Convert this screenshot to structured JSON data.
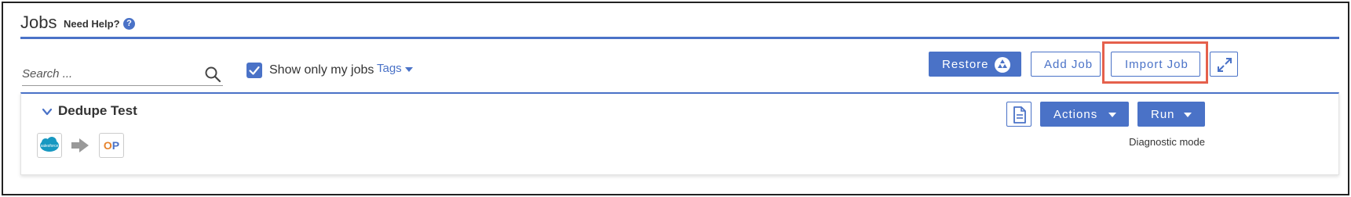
{
  "header": {
    "title": "Jobs",
    "help_label": "Need Help?",
    "help_icon": "question-circle-icon"
  },
  "toolbar": {
    "search_placeholder": "Search ...",
    "search_value": "",
    "show_only_my_jobs_label": "Show only my jobs",
    "show_only_my_jobs_checked": true,
    "tags_label": "Tags",
    "restore_label": "Restore",
    "add_job_label": "Add Job",
    "import_job_label": "Import Job"
  },
  "job": {
    "name": "Dedupe Test",
    "source_logo_text": "salesforce",
    "destination_logo_text": "OP",
    "actions_label": "Actions",
    "run_label": "Run",
    "mode_label": "Diagnostic mode"
  },
  "colors": {
    "accent": "#4a72c7",
    "highlight": "#e5604c",
    "salesforce": "#1798c1",
    "op_orange": "#e6822a"
  }
}
